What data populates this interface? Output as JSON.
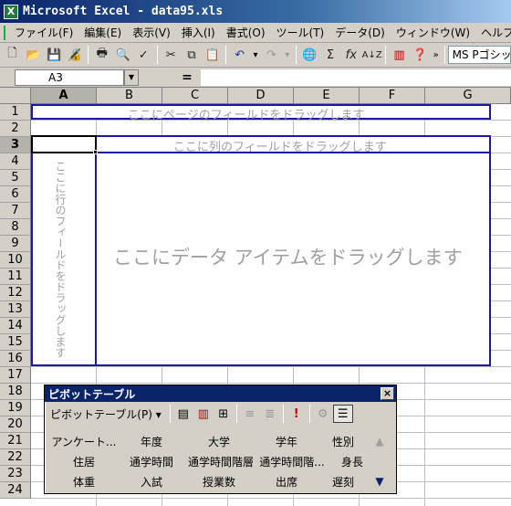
{
  "window": {
    "title": "Microsoft Excel - data95.xls",
    "app_icon_glyph": "X"
  },
  "menu": [
    "ファイル(F)",
    "編集(E)",
    "表示(V)",
    "挿入(I)",
    "書式(O)",
    "ツール(T)",
    "データ(D)",
    "ウィンドウ(W)",
    "ヘルプ(H)"
  ],
  "toolbar": {
    "font_name": "MS Pゴシック",
    "more_glyph": "»"
  },
  "formula_bar": {
    "cell_ref": "A3",
    "equals": "=",
    "value": ""
  },
  "columns": [
    "A",
    "B",
    "C",
    "D",
    "E",
    "F",
    "G"
  ],
  "rows": [
    "1",
    "2",
    "3",
    "4",
    "5",
    "6",
    "7",
    "8",
    "9",
    "10",
    "11",
    "12",
    "13",
    "14",
    "15",
    "16",
    "17",
    "18",
    "19",
    "20",
    "21",
    "22",
    "23",
    "24"
  ],
  "active": {
    "column": "A",
    "row": "3"
  },
  "pivot_area": {
    "page_field_text": "ここにページのフィールドをドラッグします",
    "column_field_text": "ここに列のフィールドをドラッグします",
    "row_field_text": "ここに行のフィールドをドラッグします",
    "data_item_text": "ここにデータ アイテムをドラッグします"
  },
  "pivot_toolbar": {
    "title": "ピボットテーブル",
    "close_glyph": "×",
    "menu_label": "ピボットテーブル(P) ▾",
    "fields": [
      "アンケート...",
      "年度",
      "大学",
      "学年",
      "性別",
      "住居",
      "通学時間",
      "通学時間階層",
      "通学時間階...",
      "身長",
      "体重",
      "入試",
      "授業数",
      "出席",
      "遅刻"
    ],
    "scroll_up_glyph": "▲",
    "scroll_down_glyph": "▼"
  },
  "colors": {
    "title_bar": "#0a246a",
    "pivot_border": "#1a1aa0",
    "face": "#d4d0c8"
  }
}
